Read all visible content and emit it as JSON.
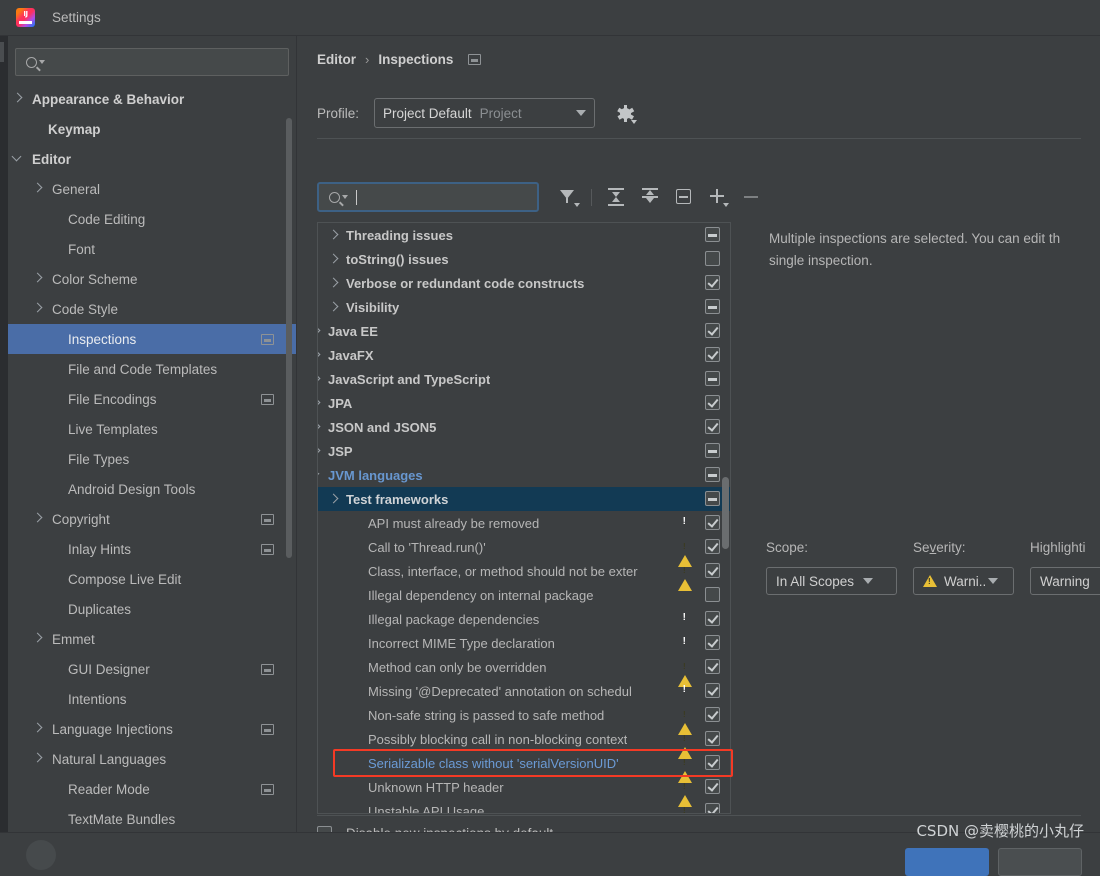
{
  "window": {
    "title": "Settings",
    "logo_icon": "intellij-idea-logo"
  },
  "sidebar": {
    "search": {
      "placeholder": "",
      "value": "",
      "icon": "search-icon"
    },
    "items": [
      {
        "label": "Appearance & Behavior",
        "indent": 24,
        "arrow": "right",
        "bold": true,
        "copy": false
      },
      {
        "label": "Keymap",
        "indent": 40,
        "arrow": "none",
        "bold": true,
        "copy": false
      },
      {
        "label": "Editor",
        "indent": 24,
        "arrow": "down",
        "bold": true,
        "copy": false
      },
      {
        "label": "General",
        "indent": 44,
        "arrow": "right",
        "bold": false,
        "copy": false
      },
      {
        "label": "Code Editing",
        "indent": 60,
        "arrow": "none",
        "bold": false,
        "copy": false
      },
      {
        "label": "Font",
        "indent": 60,
        "arrow": "none",
        "bold": false,
        "copy": false
      },
      {
        "label": "Color Scheme",
        "indent": 44,
        "arrow": "right",
        "bold": false,
        "copy": false
      },
      {
        "label": "Code Style",
        "indent": 44,
        "arrow": "right",
        "bold": false,
        "copy": false
      },
      {
        "label": "Inspections",
        "indent": 60,
        "arrow": "none",
        "bold": false,
        "copy": true,
        "selected": true
      },
      {
        "label": "File and Code Templates",
        "indent": 60,
        "arrow": "none",
        "bold": false,
        "copy": false
      },
      {
        "label": "File Encodings",
        "indent": 60,
        "arrow": "none",
        "bold": false,
        "copy": true
      },
      {
        "label": "Live Templates",
        "indent": 60,
        "arrow": "none",
        "bold": false,
        "copy": false
      },
      {
        "label": "File Types",
        "indent": 60,
        "arrow": "none",
        "bold": false,
        "copy": false
      },
      {
        "label": "Android Design Tools",
        "indent": 60,
        "arrow": "none",
        "bold": false,
        "copy": false
      },
      {
        "label": "Copyright",
        "indent": 44,
        "arrow": "right",
        "bold": false,
        "copy": true
      },
      {
        "label": "Inlay Hints",
        "indent": 60,
        "arrow": "none",
        "bold": false,
        "copy": true
      },
      {
        "label": "Compose Live Edit",
        "indent": 60,
        "arrow": "none",
        "bold": false,
        "copy": false
      },
      {
        "label": "Duplicates",
        "indent": 60,
        "arrow": "none",
        "bold": false,
        "copy": false
      },
      {
        "label": "Emmet",
        "indent": 44,
        "arrow": "right",
        "bold": false,
        "copy": false
      },
      {
        "label": "GUI Designer",
        "indent": 60,
        "arrow": "none",
        "bold": false,
        "copy": true
      },
      {
        "label": "Intentions",
        "indent": 60,
        "arrow": "none",
        "bold": false,
        "copy": false
      },
      {
        "label": "Language Injections",
        "indent": 44,
        "arrow": "right",
        "bold": false,
        "copy": true
      },
      {
        "label": "Natural Languages",
        "indent": 44,
        "arrow": "right",
        "bold": false,
        "copy": false
      },
      {
        "label": "Reader Mode",
        "indent": 60,
        "arrow": "none",
        "bold": false,
        "copy": true
      },
      {
        "label": "TextMate Bundles",
        "indent": 60,
        "arrow": "none",
        "bold": false,
        "copy": false
      }
    ]
  },
  "main": {
    "breadcrumb": {
      "parent": "Editor",
      "separator": "›",
      "current": "Inspections",
      "copy_icon": "copy-settings-icon"
    },
    "profile": {
      "label": "Profile:",
      "value": "Project Default",
      "scope_suffix": "Project",
      "gear_icon": "gear-icon"
    },
    "toolbar": {
      "search": {
        "placeholder": "",
        "value": "",
        "icon": "search-icon"
      },
      "buttons": [
        {
          "name": "filter-icon",
          "title": "Filter"
        },
        {
          "name": "expand-all-icon",
          "title": "Expand All"
        },
        {
          "name": "collapse-all-icon",
          "title": "Collapse All"
        },
        {
          "name": "reset-icon",
          "title": "Reset"
        },
        {
          "name": "add-icon",
          "title": "Add"
        },
        {
          "name": "remove-icon",
          "title": "Remove"
        }
      ]
    },
    "tree": [
      {
        "label": "Threading issues",
        "indent": 28,
        "arrow": "right",
        "bold": true,
        "check": "partial",
        "severity": "none"
      },
      {
        "label": "toString() issues",
        "indent": 28,
        "arrow": "right",
        "bold": true,
        "check": "none",
        "severity": "none"
      },
      {
        "label": "Verbose or redundant code constructs",
        "indent": 28,
        "arrow": "right",
        "bold": true,
        "check": "checked",
        "severity": "none"
      },
      {
        "label": "Visibility",
        "indent": 28,
        "arrow": "right",
        "bold": true,
        "check": "partial",
        "severity": "none"
      },
      {
        "label": "Java EE",
        "indent": 10,
        "arrow": "right",
        "bold": true,
        "check": "checked",
        "severity": "none"
      },
      {
        "label": "JavaFX",
        "indent": 10,
        "arrow": "right",
        "bold": true,
        "check": "checked",
        "severity": "none"
      },
      {
        "label": "JavaScript and TypeScript",
        "indent": 10,
        "arrow": "right",
        "bold": true,
        "check": "partial",
        "severity": "none"
      },
      {
        "label": "JPA",
        "indent": 10,
        "arrow": "right",
        "bold": true,
        "check": "checked",
        "severity": "none"
      },
      {
        "label": "JSON and JSON5",
        "indent": 10,
        "arrow": "right",
        "bold": true,
        "check": "checked",
        "severity": "none"
      },
      {
        "label": "JSP",
        "indent": 10,
        "arrow": "right",
        "bold": true,
        "check": "partial",
        "severity": "none"
      },
      {
        "label": "JVM languages",
        "indent": 10,
        "arrow": "down",
        "bold": true,
        "check": "partial",
        "severity": "none",
        "style": "jvm"
      },
      {
        "label": "Test frameworks",
        "indent": 28,
        "arrow": "right",
        "bold": true,
        "check": "partial",
        "severity": "none",
        "selected": true
      },
      {
        "label": "API must already be removed",
        "indent": 50,
        "arrow": "none",
        "bold": false,
        "check": "checked",
        "severity": "error"
      },
      {
        "label": "Call to 'Thread.run()'",
        "indent": 50,
        "arrow": "none",
        "bold": false,
        "check": "checked",
        "severity": "warning"
      },
      {
        "label": "Class, interface, or method should not be exter",
        "indent": 50,
        "arrow": "none",
        "bold": false,
        "check": "checked",
        "severity": "warning"
      },
      {
        "label": "Illegal dependency on internal package",
        "indent": 50,
        "arrow": "none",
        "bold": false,
        "check": "none",
        "severity": "none"
      },
      {
        "label": "Illegal package dependencies",
        "indent": 50,
        "arrow": "none",
        "bold": false,
        "check": "checked",
        "severity": "error"
      },
      {
        "label": "Incorrect MIME Type declaration",
        "indent": 50,
        "arrow": "none",
        "bold": false,
        "check": "checked",
        "severity": "error"
      },
      {
        "label": "Method can only be overridden",
        "indent": 50,
        "arrow": "none",
        "bold": false,
        "check": "checked",
        "severity": "warning"
      },
      {
        "label": "Missing '@Deprecated' annotation on schedul",
        "indent": 50,
        "arrow": "none",
        "bold": false,
        "check": "checked",
        "severity": "error"
      },
      {
        "label": "Non-safe string is passed to safe method",
        "indent": 50,
        "arrow": "none",
        "bold": false,
        "check": "checked",
        "severity": "warning"
      },
      {
        "label": "Possibly blocking call in non-blocking context",
        "indent": 50,
        "arrow": "none",
        "bold": false,
        "check": "checked",
        "severity": "warning"
      },
      {
        "label": "Serializable class without 'serialVersionUID'",
        "indent": 50,
        "arrow": "none",
        "bold": false,
        "check": "checked",
        "severity": "warning",
        "highlighted": true
      },
      {
        "label": "Unknown HTTP header",
        "indent": 50,
        "arrow": "none",
        "bold": false,
        "check": "checked",
        "severity": "warning"
      },
      {
        "label": "Unstable API Usage",
        "indent": 50,
        "arrow": "none",
        "bold": false,
        "check": "checked",
        "severity": "warning"
      }
    ],
    "detail": {
      "line1": "Multiple inspections are selected. You can edit th",
      "line2": "single inspection.",
      "scope": {
        "label": "Scope:",
        "value": "In All Scopes"
      },
      "severity": {
        "label_pre": "Se",
        "label_key": "v",
        "label_post": "erity:",
        "value": "Warni..",
        "icon": "warning-triangle-icon"
      },
      "highlighting": {
        "label": "Highlighti",
        "value": "Warning"
      }
    },
    "bottom": {
      "disable_new_label": "Disable new inspections by default",
      "disable_new_checked": false
    }
  },
  "watermark": "CSDN @卖樱桃的小丸仔",
  "colors": {
    "background": "#3c3f41",
    "sidebar_selection": "#4a6da7",
    "tree_selection": "#123a54",
    "accent_link": "#6897d0",
    "highlight_box": "#f43a25",
    "warning": "#e8bf36",
    "error": "#c9342f"
  }
}
